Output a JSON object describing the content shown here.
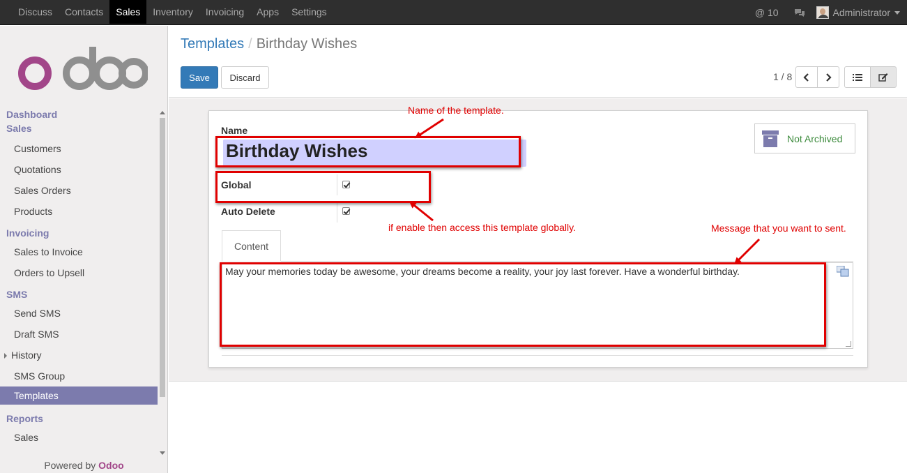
{
  "topbar": {
    "menu": [
      "Discuss",
      "Contacts",
      "Sales",
      "Inventory",
      "Invoicing",
      "Apps",
      "Settings"
    ],
    "active_menu": "Sales",
    "mentions": "@ 10",
    "user": "Administrator"
  },
  "sidebar": {
    "logo_text": "odoo",
    "sections": [
      {
        "header": "Dashboard"
      },
      {
        "header": "Sales",
        "items": [
          "Customers",
          "Quotations",
          "Sales Orders",
          "Products"
        ]
      },
      {
        "header": "Invoicing",
        "items": [
          "Sales to Invoice",
          "Orders to Upsell"
        ]
      },
      {
        "header": "SMS",
        "items": [
          "Send SMS",
          "Draft SMS",
          "History",
          "SMS Group",
          "Templates"
        ]
      },
      {
        "header": "Reports",
        "items": [
          "Sales"
        ]
      }
    ],
    "selected_item": "Templates",
    "powered_by": "Powered by",
    "powered_brand": "Odoo"
  },
  "control_panel": {
    "breadcrumb_parent": "Templates",
    "breadcrumb_separator": "/",
    "breadcrumb_current": "Birthday Wishes",
    "save_label": "Save",
    "discard_label": "Discard",
    "pager": "1 / 8"
  },
  "form": {
    "name_label": "Name",
    "name_value": "Birthday Wishes",
    "global_label": "Global",
    "global_checked": true,
    "auto_delete_label": "Auto Delete",
    "auto_delete_checked": true,
    "archive_button": "Not Archived",
    "tab_label": "Content",
    "content_text": "May your memories today be awesome, your dreams become a reality, your joy last forever. Have a wonderful birthday."
  },
  "annotations": {
    "name_note": "Name of the template.",
    "global_note": "if enable then access this template globally.",
    "content_note": "Message that you want to sent."
  },
  "colors": {
    "brand_purple": "#7c7bad",
    "primary_blue": "#337ab7",
    "annotation_red": "#e00000",
    "odoo_magenta": "#a24689"
  }
}
